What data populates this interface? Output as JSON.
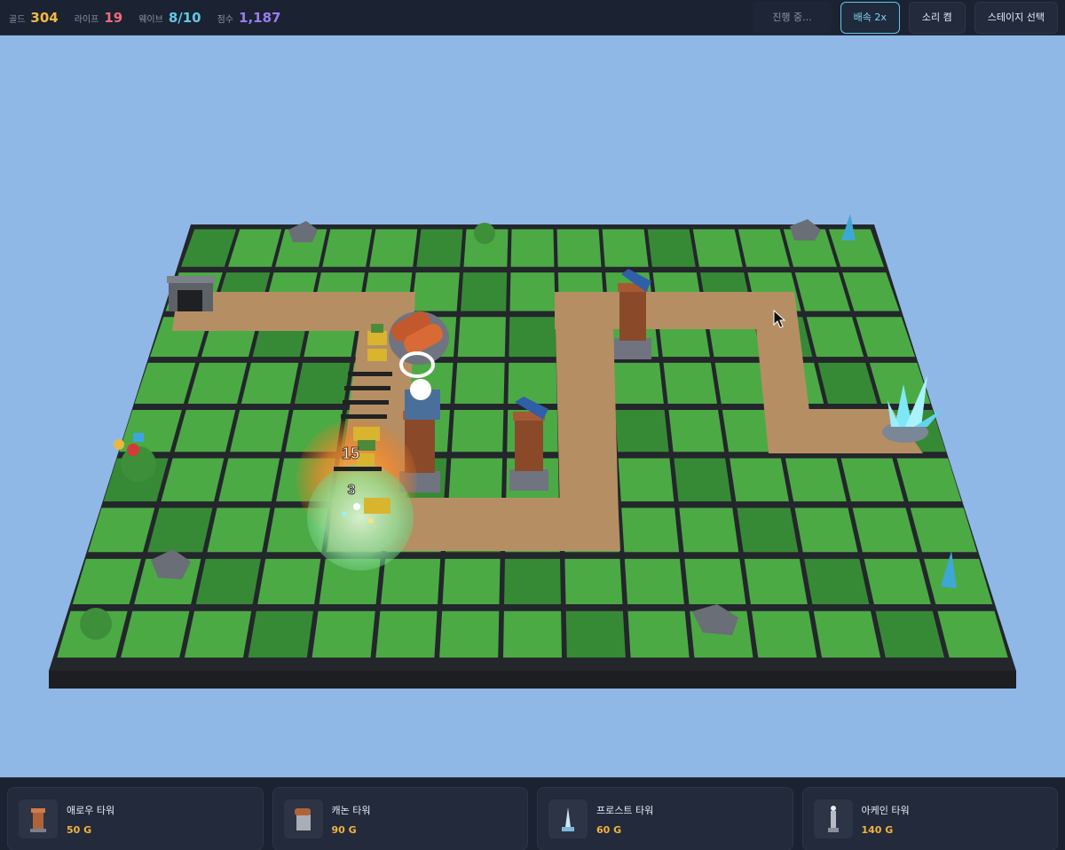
{
  "hud": {
    "stats": [
      {
        "label": "골드",
        "value": "304",
        "color": "#f5b942"
      },
      {
        "label": "라이프",
        "value": "19",
        "color": "#f06a7a"
      },
      {
        "label": "웨이브",
        "value": "8/10",
        "color": "#5ec8e8"
      },
      {
        "label": "점수",
        "value": "1,187",
        "color": "#9b7cf0"
      }
    ],
    "status_text": "진행 중...",
    "speed_label": "배속 2x",
    "sound_label": "소리 켬",
    "stage_label": "스테이지 선택"
  },
  "scene": {
    "damage_numbers": [
      "15",
      "3"
    ]
  },
  "shop": {
    "towers": [
      {
        "name": "애로우 타워",
        "cost": "50 G",
        "icon": "arrow-tower-icon"
      },
      {
        "name": "캐논 타워",
        "cost": "90 G",
        "icon": "cannon-tower-icon"
      },
      {
        "name": "프로스트 타워",
        "cost": "60 G",
        "icon": "frost-tower-icon"
      },
      {
        "name": "아케인 타워",
        "cost": "140 G",
        "icon": "arcane-tower-icon"
      }
    ]
  },
  "colors": {
    "sky": "#8fb8e6",
    "grass_light": "#4caa44",
    "grass_dark": "#378a35",
    "path": "#b58f63",
    "board_edge": "#23262b"
  }
}
